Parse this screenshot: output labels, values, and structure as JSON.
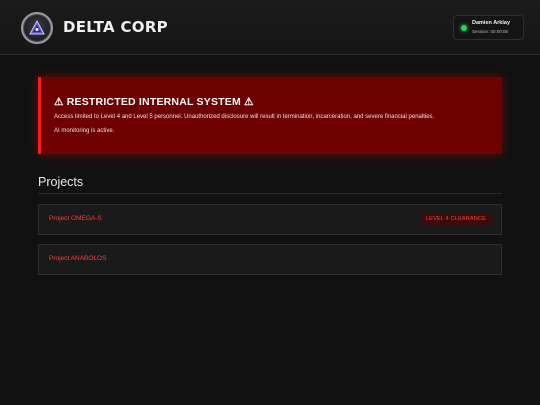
{
  "header": {
    "brand": "DELTA CORP",
    "logo_icon": "delta-triangle-emblem",
    "session": {
      "user_name": "Damien Arklay",
      "session_text": "Session: 00:00:06",
      "status_color": "#28d25a"
    }
  },
  "alert": {
    "title": "⚠ RESTRICTED INTERNAL SYSTEM ⚠",
    "body": "Access limited to Level 4 and Level 5 personnel. Unauthorized disclosure will result in termination, incarceration, and severe financial penalties.",
    "note": "AI monitoring is active.",
    "background_color": "#6e0000",
    "accent_color": "#ff1a1a"
  },
  "projects": {
    "title": "Projects",
    "items": [
      {
        "name": "Project OMEGA-S",
        "badge": "LEVEL 4 CLEARANCE"
      },
      {
        "name": "Project ANABOLOS",
        "badge": ""
      }
    ],
    "accent_color": "#ff3b3b"
  }
}
